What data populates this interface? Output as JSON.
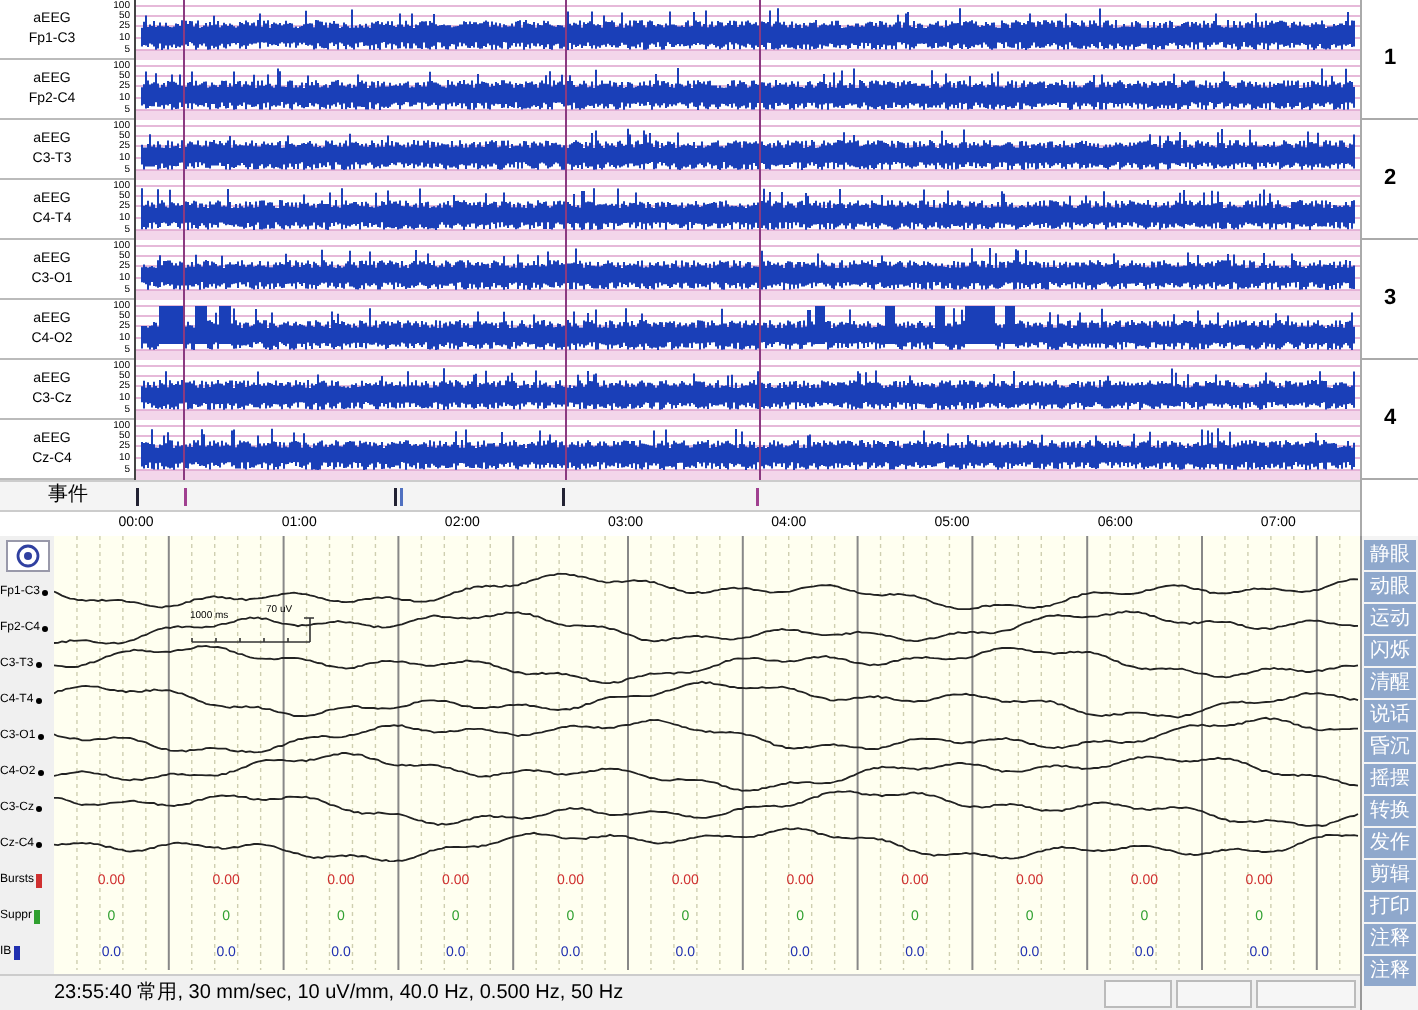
{
  "aeeg": {
    "channels": [
      {
        "type": "aEEG",
        "name": "Fp1-C3",
        "y_ticks": [
          "100",
          "50",
          "25",
          "10",
          "5"
        ]
      },
      {
        "type": "aEEG",
        "name": "Fp2-C4",
        "y_ticks": [
          "100",
          "50",
          "25",
          "10",
          "5"
        ]
      },
      {
        "type": "aEEG",
        "name": "C3-T3",
        "y_ticks": [
          "100",
          "50",
          "25",
          "10",
          "5"
        ]
      },
      {
        "type": "aEEG",
        "name": "C4-T4",
        "y_ticks": [
          "100",
          "50",
          "25",
          "10",
          "5"
        ]
      },
      {
        "type": "aEEG",
        "name": "C3-O1",
        "y_ticks": [
          "100",
          "50",
          "25",
          "10",
          "5"
        ]
      },
      {
        "type": "aEEG",
        "name": "C4-O2",
        "y_ticks": [
          "100",
          "50",
          "25",
          "10",
          "5"
        ]
      },
      {
        "type": "aEEG",
        "name": "C3-Cz",
        "y_ticks": [
          "100",
          "50",
          "25",
          "10",
          "5"
        ]
      },
      {
        "type": "aEEG",
        "name": "Cz-C4",
        "y_ticks": [
          "100",
          "50",
          "25",
          "10",
          "5"
        ]
      }
    ],
    "groups": [
      "1",
      "2",
      "3",
      "4"
    ],
    "event_label": "事件",
    "time_axis": [
      "00:00",
      "01:00",
      "02:00",
      "03:00",
      "04:00",
      "05:00",
      "06:00",
      "07:00"
    ]
  },
  "eeg": {
    "channels": [
      "Fp1-C3",
      "Fp2-C4",
      "C3-T3",
      "C4-T4",
      "C3-O1",
      "C4-O2",
      "C3-Cz",
      "Cz-C4"
    ],
    "scale": {
      "time": "1000 ms",
      "amplitude": "70 uV"
    },
    "stats": [
      {
        "label": "Bursts",
        "color": "#d03030",
        "values": [
          "0.00",
          "0.00",
          "0.00",
          "0.00",
          "0.00",
          "0.00",
          "0.00",
          "0.00",
          "0.00",
          "0.00",
          "0.00"
        ]
      },
      {
        "label": "Suppr",
        "color": "#30a030",
        "values": [
          "0",
          "0",
          "0",
          "0",
          "0",
          "0",
          "0",
          "0",
          "0",
          "0",
          "0"
        ]
      },
      {
        "label": "IB",
        "color": "#2030b0",
        "values": [
          "0.0",
          "0.0",
          "0.0",
          "0.0",
          "0.0",
          "0.0",
          "0.0",
          "0.0",
          "0.0",
          "0.0",
          "0.0"
        ]
      }
    ],
    "buttons": [
      "静眼",
      "动眼",
      "运动",
      "闪烁",
      "清醒",
      "说话",
      "昏沉",
      "摇摆",
      "转换",
      "发作",
      "剪辑",
      "打印",
      "注释",
      "注释"
    ],
    "status": "23:55:40 常用, 30 mm/sec, 10 uV/mm, 40.0 Hz, 0.500 Hz, 50 Hz"
  }
}
